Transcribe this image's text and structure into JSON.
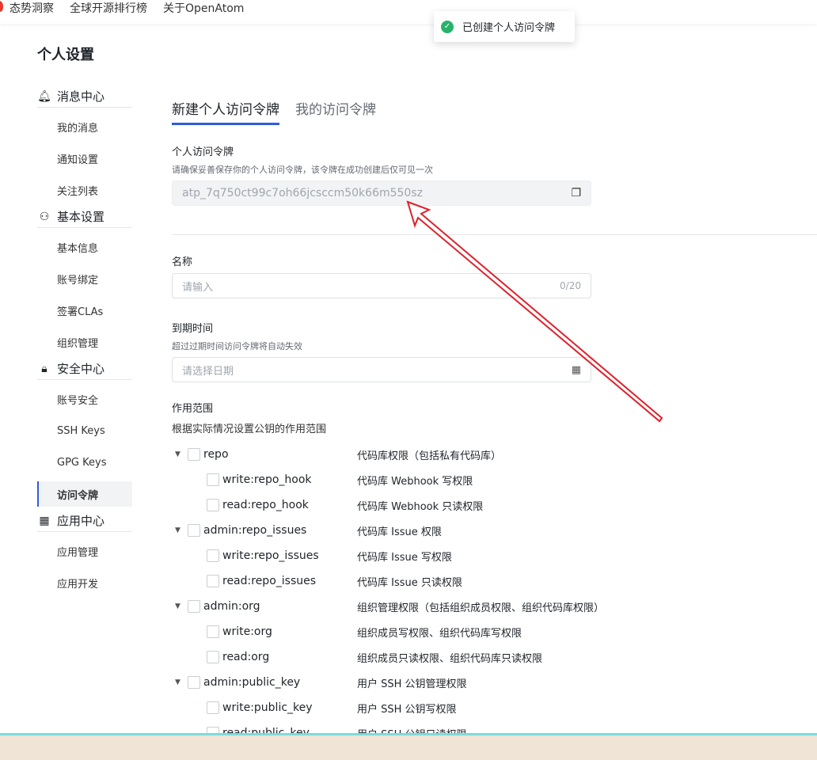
{
  "topnav": {
    "items": [
      "态势洞察",
      "全球开源排行榜",
      "关于OpenAtom"
    ]
  },
  "toast": {
    "message": "已创建个人访问令牌",
    "icon": "check-circle-icon",
    "color": "#27b36a"
  },
  "page_title": "个人设置",
  "sidebar": [
    {
      "title": "消息中心",
      "icon": "bell-icon",
      "items": [
        "我的消息",
        "通知设置",
        "关注列表"
      ]
    },
    {
      "title": "基本设置",
      "icon": "user-icon",
      "items": [
        "基本信息",
        "账号绑定",
        "签署CLAs",
        "组织管理"
      ]
    },
    {
      "title": "安全中心",
      "icon": "lock-icon",
      "items": [
        "账号安全",
        "SSH Keys",
        "GPG Keys",
        "访问令牌"
      ]
    },
    {
      "title": "应用中心",
      "icon": "apps-icon",
      "items": [
        "应用管理",
        "应用开发"
      ]
    }
  ],
  "active_item": "访问令牌",
  "tabs": [
    "新建个人访问令牌",
    "我的访问令牌"
  ],
  "token": {
    "label": "个人访问令牌",
    "hint": "请确保妥善保存你的个人访问令牌，该令牌在成功创建后仅可见一次",
    "value": "atp_7q750ct99c7oh66jcsccm50k66m550sz"
  },
  "name": {
    "label": "名称",
    "placeholder": "请输入",
    "count": "0/20"
  },
  "expiry": {
    "label": "到期时间",
    "hint": "超过过期时间访问令牌将自动失效",
    "placeholder": "请选择日期"
  },
  "scope": {
    "label": "作用范围",
    "hint": "根据实际情况设置公钥的作用范围",
    "rows": [
      {
        "name": "repo",
        "desc": "代码库权限（包括私有代码库）",
        "parent": true
      },
      {
        "name": "write:repo_hook",
        "desc": "代码库 Webhook 写权限"
      },
      {
        "name": "read:repo_hook",
        "desc": "代码库 Webhook 只读权限"
      },
      {
        "name": "admin:repo_issues",
        "desc": "代码库 Issue 权限",
        "parent": true
      },
      {
        "name": "write:repo_issues",
        "desc": "代码库 Issue 写权限"
      },
      {
        "name": "read:repo_issues",
        "desc": "代码库 Issue 只读权限"
      },
      {
        "name": "admin:org",
        "desc": "组织管理权限（包括组织成员权限、组织代码库权限）",
        "parent": true
      },
      {
        "name": "write:org",
        "desc": "组织成员写权限、组织代码库写权限"
      },
      {
        "name": "read:org",
        "desc": "组织成员只读权限、组织代码库只读权限"
      },
      {
        "name": "admin:public_key",
        "desc": "用户 SSH 公钥管理权限",
        "parent": true
      },
      {
        "name": "write:public_key",
        "desc": "用户 SSH 公钥写权限"
      },
      {
        "name": "read:public_key",
        "desc": "用户 SSH 公钥只读权限"
      }
    ]
  },
  "annotation_color": "#e0202a"
}
